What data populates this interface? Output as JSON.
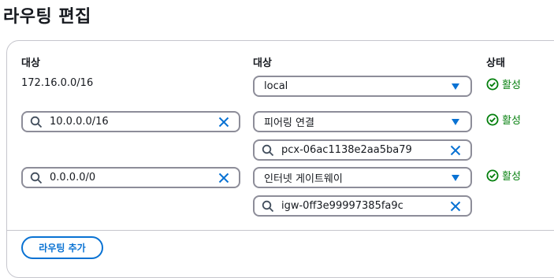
{
  "page": {
    "title": "라우팅 편집"
  },
  "columns": {
    "destination": "대상",
    "target": "대상",
    "status": "상태"
  },
  "routes": [
    {
      "destination": "172.16.0.0/16",
      "target_type": "local",
      "target_id": null,
      "status": "활성"
    },
    {
      "destination": "10.0.0.0/16",
      "target_type": "피어링 연결",
      "target_id": "pcx-06ac1138e2aa5ba79",
      "status": "활성"
    },
    {
      "destination": "0.0.0.0/0",
      "target_type": "인터넷 게이트웨이",
      "target_id": "igw-0ff3e99997385fa9c",
      "status": "활성"
    }
  ],
  "actions": {
    "add_route": "라우팅 추가"
  },
  "colors": {
    "accent": "#0972d3",
    "success": "#037f0c",
    "border": "#8d8d99"
  }
}
